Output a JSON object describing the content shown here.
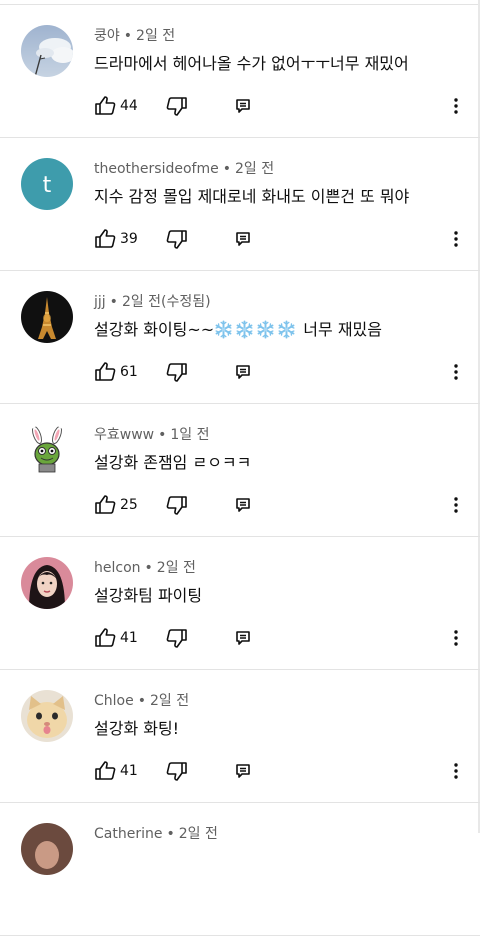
{
  "comments": [
    {
      "author": "쿵야",
      "time": "2일 전",
      "text": "드라마에서 헤어나올 수가 없어ㅜㅜ너무 재밌어",
      "likes": "44",
      "avatar": "sky-photo"
    },
    {
      "author": "theothersideofme",
      "time": "2일 전",
      "text": "지수 감정 몰입 제대로네 화내도 이쁜건 또 뭐야",
      "likes": "39",
      "avatar": "letter",
      "avatar_letter": "t",
      "avatar_color": "#3e9cac"
    },
    {
      "author": "jjj",
      "time": "2일 전(수정됨)",
      "text_before": "설강화 화이팅~~",
      "text_after": " 너무 재밌음",
      "snowflakes": 4,
      "likes": "61",
      "avatar": "eiffel-photo"
    },
    {
      "author": "우효www",
      "time": "1일 전",
      "text": "설강화 존잼임 ㄹㅇㅋㅋ",
      "likes": "25",
      "avatar": "character-illustration"
    },
    {
      "author": "helcon",
      "time": "2일 전",
      "text": "설강화팀 파이팅",
      "likes": "41",
      "avatar": "portrait-photo"
    },
    {
      "author": "Chloe",
      "time": "2일 전",
      "text": "설강화 화팅!",
      "likes": "41",
      "avatar": "cat-photo"
    },
    {
      "author": "Catherine",
      "time": "2일 전",
      "text": "",
      "likes": "",
      "avatar": "partial-photo"
    }
  ],
  "icons": {
    "like": "thumbs-up-icon",
    "dislike": "thumbs-down-icon",
    "reply": "reply-comment-icon",
    "more": "more-vertical-icon",
    "snowflake": "snowflake-emoji-icon"
  },
  "colors": {
    "text": "#0f0f0f",
    "meta": "#606060",
    "divider": "#e3e3e3"
  }
}
